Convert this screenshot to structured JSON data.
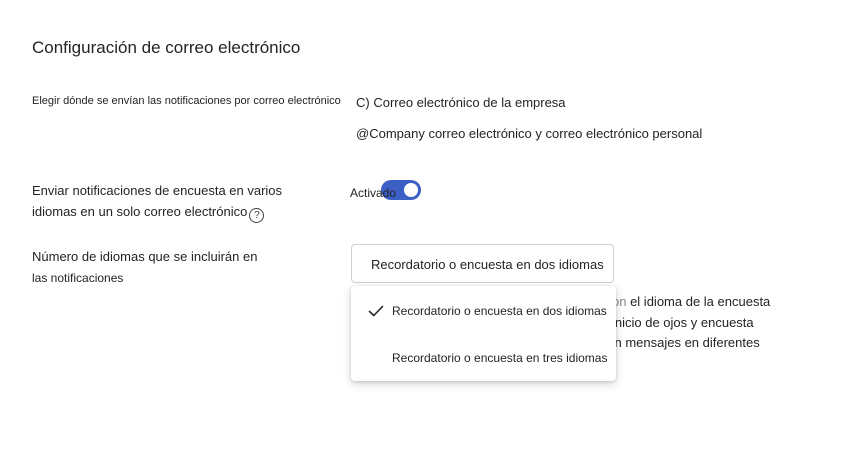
{
  "page": {
    "title": "Configuración de correo electrónico"
  },
  "notifications_destination": {
    "label": "Elegir dónde se envían las notificaciones por correo electrónico",
    "options": [
      "C) Correo electrónico de la empresa",
      "@Company correo electrónico y correo electrónico personal"
    ]
  },
  "multilang": {
    "label_line1": "Enviar notificaciones de encuesta en varios",
    "label_line2": "idiomas en un solo correo electrónico",
    "help_icon": "question-circle-icon",
    "help_glyph": "?",
    "toggle_label": "Activado",
    "toggle_on": true,
    "accent_color": "#3b5fc4"
  },
  "language_count": {
    "label_line1": "Número de idiomas que se incluirán en",
    "label_line2": "las notificaciones",
    "selected": "Recordatorio o encuesta en dos idiomas",
    "options": [
      "Recordatorio o encuesta en dos idiomas",
      "Recordatorio o encuesta en tres idiomas"
    ],
    "check_icon": "checkmark-icon"
  },
  "partial_description": {
    "line1_prefix": "on",
    "line1": " el idioma de la encuesta",
    "line2": "inicio de ojos y encuesta",
    "line3": "'n mensajes en diferentes"
  }
}
